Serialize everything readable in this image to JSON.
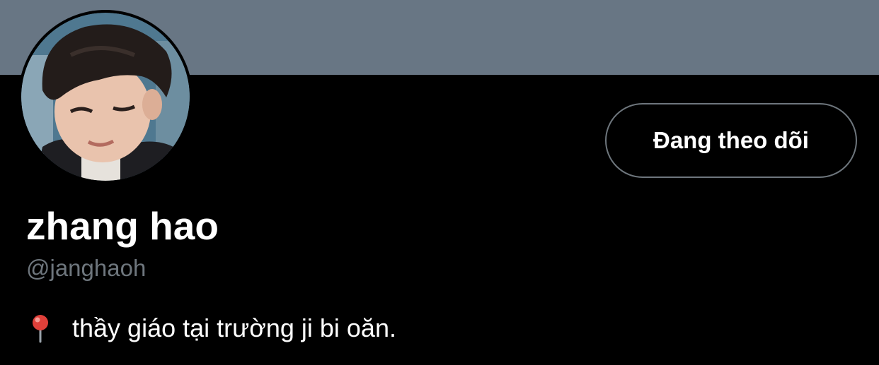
{
  "header": {
    "banner_color": "#687684"
  },
  "profile": {
    "avatar_icon": "avatar",
    "display_name": "zhang hao",
    "handle": "@janghaoh",
    "bio_icon": "round-pushpin-icon",
    "bio": "thầy giáo tại trường ji bi oăn."
  },
  "actions": {
    "follow_label": "Đang theo dõi"
  },
  "colors": {
    "background": "#000000",
    "text_primary": "#ffffff",
    "text_secondary": "#6e767d",
    "button_border": "#6e767d"
  }
}
